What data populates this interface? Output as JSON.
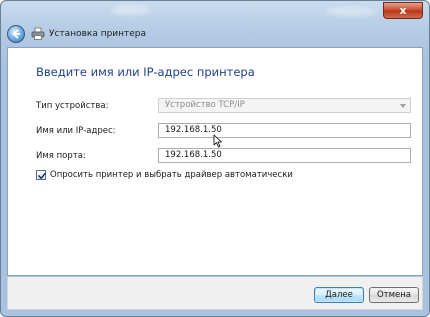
{
  "window": {
    "title": "Установка принтера",
    "close_glyph": "x"
  },
  "main": {
    "heading": "Введите имя или IP-адрес принтера",
    "device_type": {
      "label": "Тип устройства:",
      "value": "Устройство TCP/IP"
    },
    "host": {
      "label": "Имя или IP-адрес:",
      "value": "192.168.1.50"
    },
    "port": {
      "label": "Имя порта:",
      "value": "192.168.1.50"
    },
    "auto_driver": {
      "label": "Опросить принтер и выбрать драйвер автоматически",
      "checked": true
    }
  },
  "footer": {
    "next_label": "Далее",
    "cancel_label": "Отмена"
  },
  "icons": {
    "back": "back-arrow-icon",
    "printer": "printer-icon",
    "close": "close-icon",
    "checkmark": "checkmark-icon",
    "cursor": "text-cursor-icon"
  },
  "colors": {
    "heading": "#1f3f8a",
    "close_button": "#c8452b",
    "default_button": "#bee6fd",
    "window_frame": "#b4cbe4"
  }
}
